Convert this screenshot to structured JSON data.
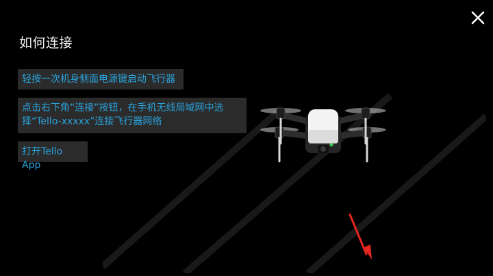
{
  "dialog": {
    "title": "如何连接",
    "close_icon": "close-icon"
  },
  "steps": [
    {
      "text": "轻按一次机身侧面电源键启动飞行器"
    },
    {
      "line1": "点击右下角“连接”按钮，在手机无线局域网中选",
      "line2": "择“Tello-xxxxx”连接飞行器网络"
    },
    {
      "text": "打开Tello App"
    }
  ],
  "illustration": {
    "icon": "drone-icon"
  },
  "annotation": {
    "icon": "red-arrow-icon",
    "color": "#e6261f"
  },
  "colors": {
    "background": "#000000",
    "step_background": "#2b2b2b",
    "step_text": "#2aa3dd",
    "title_text": "#f2f2f2"
  }
}
